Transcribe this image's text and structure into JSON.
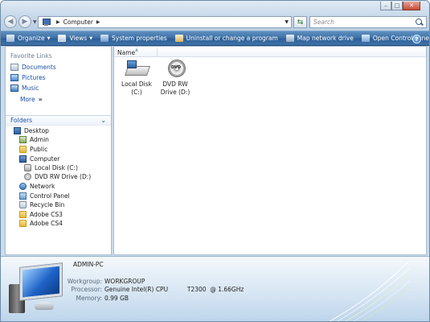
{
  "window": {
    "address": {
      "location": "Computer"
    },
    "search": {
      "placeholder": "Search"
    },
    "controls": {
      "minimize": "–",
      "maximize": "□",
      "close": "✕"
    }
  },
  "toolbar": {
    "items": [
      {
        "label": "Organize",
        "icon": "organize-icon",
        "dropdown": true
      },
      {
        "label": "Views",
        "icon": "views-icon",
        "dropdown": true
      },
      {
        "label": "System properties",
        "icon": "system-properties-icon"
      },
      {
        "label": "Uninstall or change a program",
        "icon": "uninstall-icon"
      },
      {
        "label": "Map network drive",
        "icon": "map-drive-icon"
      },
      {
        "label": "Open Control Panel",
        "icon": "control-panel-icon"
      }
    ],
    "help": "?"
  },
  "favorite_links": {
    "heading": "Favorite Links",
    "items": [
      "Documents",
      "Pictures",
      "Music"
    ],
    "more": "More"
  },
  "folders": {
    "heading": "Folders",
    "tree": [
      {
        "label": "Desktop",
        "icon": "desktop"
      },
      {
        "label": "Admin",
        "icon": "user"
      },
      {
        "label": "Public",
        "icon": "folder"
      },
      {
        "label": "Computer",
        "icon": "computer"
      },
      {
        "label": "Local Disk (C:)",
        "icon": "disk"
      },
      {
        "label": "DVD RW Drive (D:)",
        "icon": "dvd"
      },
      {
        "label": "Network",
        "icon": "network"
      },
      {
        "label": "Control Panel",
        "icon": "cpanel"
      },
      {
        "label": "Recycle Bin",
        "icon": "bin"
      },
      {
        "label": "Adobe CS3",
        "icon": "folder"
      },
      {
        "label": "Adobe CS4",
        "icon": "folder"
      }
    ]
  },
  "content": {
    "column_header": "Name",
    "drives": [
      {
        "line1": "Local Disk",
        "line2": "(C:)",
        "icon": "hard-disk-icon"
      },
      {
        "line1": "DVD RW",
        "line2": "Drive (D:)",
        "icon": "dvd-drive-icon"
      }
    ]
  },
  "details": {
    "computer_name": "ADMIN-PC",
    "workgroup_label": "Workgroup:",
    "workgroup": "WORKGROUP",
    "processor_label": "Processor:",
    "processor": "Genuine Intel(R) CPU          T2300  @ 1.66GHz",
    "memory_label": "Memory:",
    "memory": "0.99 GB"
  },
  "colors": {
    "toolbar": "#3c6ea4",
    "link": "#1b4fa3",
    "details_bg": "#d7e6f3"
  }
}
